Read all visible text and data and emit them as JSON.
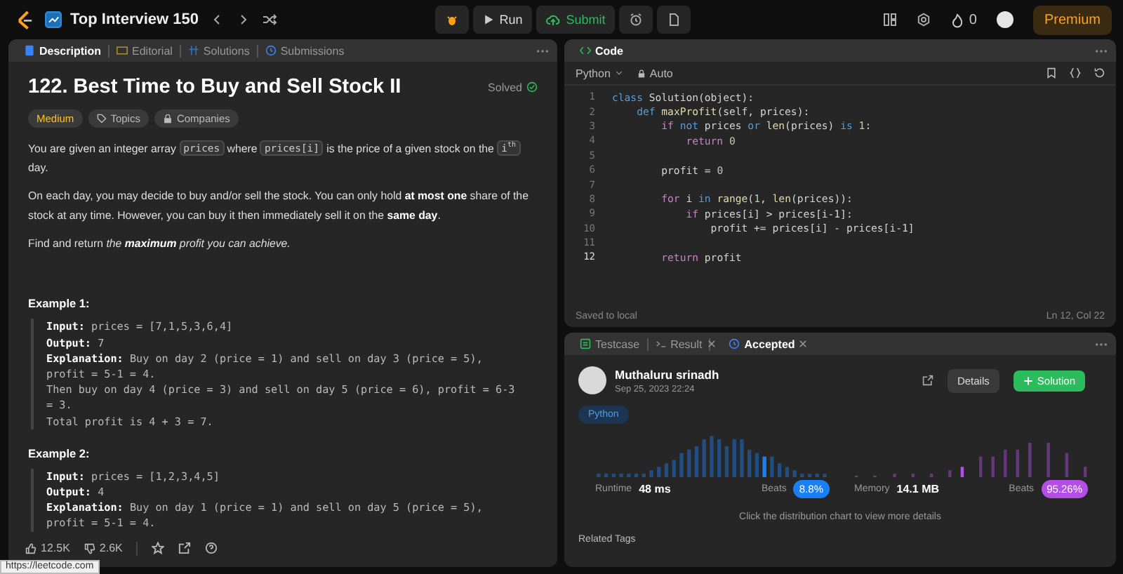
{
  "topbar": {
    "title": "Top Interview 150",
    "run": "Run",
    "submit": "Submit",
    "streak": "0",
    "premium": "Premium"
  },
  "description_panel": {
    "tabs": [
      {
        "label": "Description",
        "selected": true
      },
      {
        "label": "Editorial",
        "selected": false
      },
      {
        "label": "Solutions",
        "selected": false
      },
      {
        "label": "Submissions",
        "selected": false
      }
    ],
    "title": "122. Best Time to Buy and Sell Stock II",
    "status": "Solved",
    "tags": [
      {
        "label": "Medium",
        "kind": "difficulty"
      },
      {
        "label": "Topics",
        "kind": "topics"
      },
      {
        "label": "Companies",
        "kind": "companies"
      }
    ],
    "paragraphs": [
      [
        {
          "text": "You are given an integer array ",
          "kind": "text"
        },
        {
          "text": "prices",
          "kind": "code"
        },
        {
          "text": " where ",
          "kind": "text"
        },
        {
          "text": "prices[i]",
          "kind": "code"
        },
        {
          "text": " is the price of a given stock on the ",
          "kind": "text"
        },
        {
          "text": "i$^{th}$",
          "kind": "code"
        },
        {
          "text": " day.",
          "kind": "text"
        }
      ],
      [
        {
          "text": "On each day, you may decide to buy and/or sell the stock. You can only hold **at most one** share of the stock at any time. However, you can buy it then immediately sell it on the **same day**.",
          "kind": "text"
        }
      ],
      [
        {
          "text": "Find and return ",
          "kind": "text"
        },
        {
          "text": "the **maximum** profit you can achieve.",
          "kind": "em"
        }
      ]
    ],
    "examples": [
      {
        "heading": "Example 1:",
        "lines": [
          "**Input:** prices = [7,1,5,3,6,4]",
          "**Output:** 7",
          "**Explanation:** Buy on day 2 (price = 1) and sell on day 3 (price = 5),",
          "profit = 5-1 = 4.",
          "Then buy on day 4 (price = 3) and sell on day 5 (price = 6), profit = 6-3",
          "= 3.",
          "Total profit is 4 + 3 = 7."
        ]
      },
      {
        "heading": "Example 2:",
        "lines": [
          "**Input:** prices = [1,2,3,4,5]",
          "**Output:** 4",
          "**Explanation:** Buy on day 1 (price = 1) and sell on day 5 (price = 5),",
          "profit = 5-1 = 4."
        ]
      }
    ],
    "footer": {
      "likes": "12.5K",
      "dislikes": "2.6K"
    }
  },
  "code_panel": {
    "title": "Code",
    "language": "Python",
    "mode": "Auto",
    "lines": [
      {
        "number": "1",
        "active": false,
        "tokens": [
          {
            "text": "class",
            "kind": "kw"
          },
          {
            "text": " Solution(object):",
            "kind": "plain"
          }
        ]
      },
      {
        "number": "2",
        "active": false,
        "tokens": [
          {
            "text": "    def ",
            "kind": "kw"
          },
          {
            "text": "maxProfit",
            "kind": "fn"
          },
          {
            "text": "(self, prices):",
            "kind": "plain"
          }
        ]
      },
      {
        "number": "3",
        "active": false,
        "tokens": [
          {
            "text": "        if",
            "kind": "ctl"
          },
          {
            "text": " not",
            "kind": "kw"
          },
          {
            "text": " prices ",
            "kind": "plain"
          },
          {
            "text": "or ",
            "kind": "kw"
          },
          {
            "text": "len",
            "kind": "fn"
          },
          {
            "text": "(prices) ",
            "kind": "plain"
          },
          {
            "text": "is ",
            "kind": "kw"
          },
          {
            "text": "1",
            "kind": "num"
          },
          {
            "text": ":",
            "kind": "plain"
          }
        ]
      },
      {
        "number": "4",
        "active": false,
        "tokens": [
          {
            "text": "            return ",
            "kind": "ctl"
          },
          {
            "text": "0",
            "kind": "num"
          }
        ]
      },
      {
        "number": "5",
        "active": false
      },
      {
        "number": "6",
        "active": false,
        "tokens": [
          {
            "text": "        profit = ",
            "kind": "plain"
          },
          {
            "text": "0",
            "kind": "num"
          }
        ]
      },
      {
        "number": "7",
        "active": false
      },
      {
        "number": "8",
        "active": false,
        "tokens": [
          {
            "text": "        for",
            "kind": "ctl"
          },
          {
            "text": " i ",
            "kind": "plain"
          },
          {
            "text": "in ",
            "kind": "kw"
          },
          {
            "text": "range",
            "kind": "fn"
          },
          {
            "text": "(",
            "kind": "plain"
          },
          {
            "text": "1",
            "kind": "num"
          },
          {
            "text": ", ",
            "kind": "plain"
          },
          {
            "text": "len",
            "kind": "fn"
          },
          {
            "text": "(prices)):",
            "kind": "plain"
          }
        ]
      },
      {
        "number": "9",
        "active": false,
        "tokens": [
          {
            "text": "            if",
            "kind": "ctl"
          },
          {
            "text": " prices[i] > prices[i-1]:",
            "kind": "plain"
          }
        ]
      },
      {
        "number": "10",
        "active": false,
        "tokens": [
          {
            "text": "                profit += prices[i] - prices[i-1]",
            "kind": "plain"
          }
        ]
      },
      {
        "number": "11",
        "active": false
      },
      {
        "number": "12",
        "active": true,
        "tokens": [
          {
            "text": "        return",
            "kind": "ctl"
          },
          {
            "text": " profit",
            "kind": "plain"
          }
        ]
      }
    ],
    "save_status": "Saved to local",
    "cursor": "Ln 12, Col 22"
  },
  "result_panel": {
    "tabs": [
      {
        "label": "Testcase",
        "selected": false,
        "closable": false
      },
      {
        "label": "Result",
        "selected": false,
        "closable": true
      },
      {
        "label": "Accepted",
        "selected": true,
        "closable": true
      }
    ],
    "user": "Muthaluru srinadh",
    "date": "Sep 25, 2023 22:24",
    "details": "Details",
    "solution": "Solution",
    "language": "Python",
    "stats": [
      {
        "label": "Runtime",
        "value": "48 ms",
        "beats_label": "Beats",
        "beats": "8.8%",
        "color": "#1a7ff5"
      },
      {
        "label": "Memory",
        "value": "14.1 MB",
        "beats_label": "Beats",
        "beats": "95.26%",
        "color": "#b44ee6"
      }
    ],
    "hint": "Click the distribution chart to view more details",
    "related": "Related Tags"
  },
  "browser_status": "https://leetcode.com"
}
